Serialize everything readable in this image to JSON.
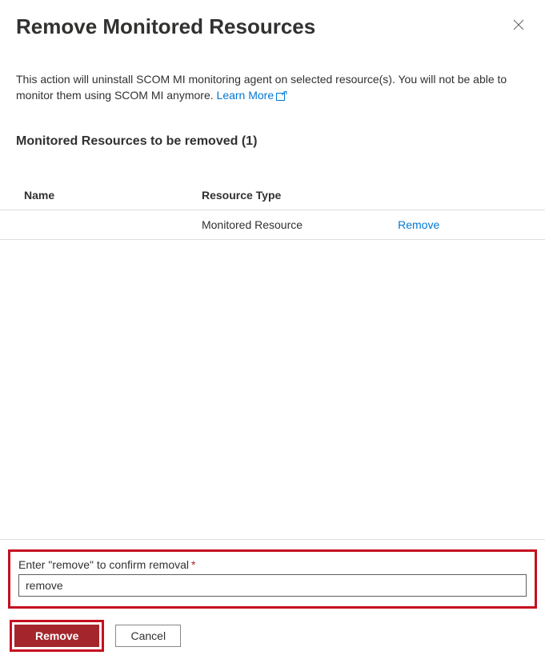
{
  "title": "Remove Monitored Resources",
  "description": "This action will uninstall SCOM MI monitoring agent on selected resource(s). You will not be able to monitor them using SCOM MI anymore. ",
  "learnMore": "Learn More",
  "subheading": "Monitored Resources to be removed (1)",
  "table": {
    "headers": {
      "name": "Name",
      "resourceType": "Resource Type",
      "action": ""
    },
    "rows": [
      {
        "name": "",
        "resourceType": "Monitored Resource",
        "action": "Remove"
      }
    ]
  },
  "confirm": {
    "label": "Enter \"remove\" to confirm removal",
    "value": "remove"
  },
  "buttons": {
    "primary": "Remove",
    "secondary": "Cancel"
  }
}
